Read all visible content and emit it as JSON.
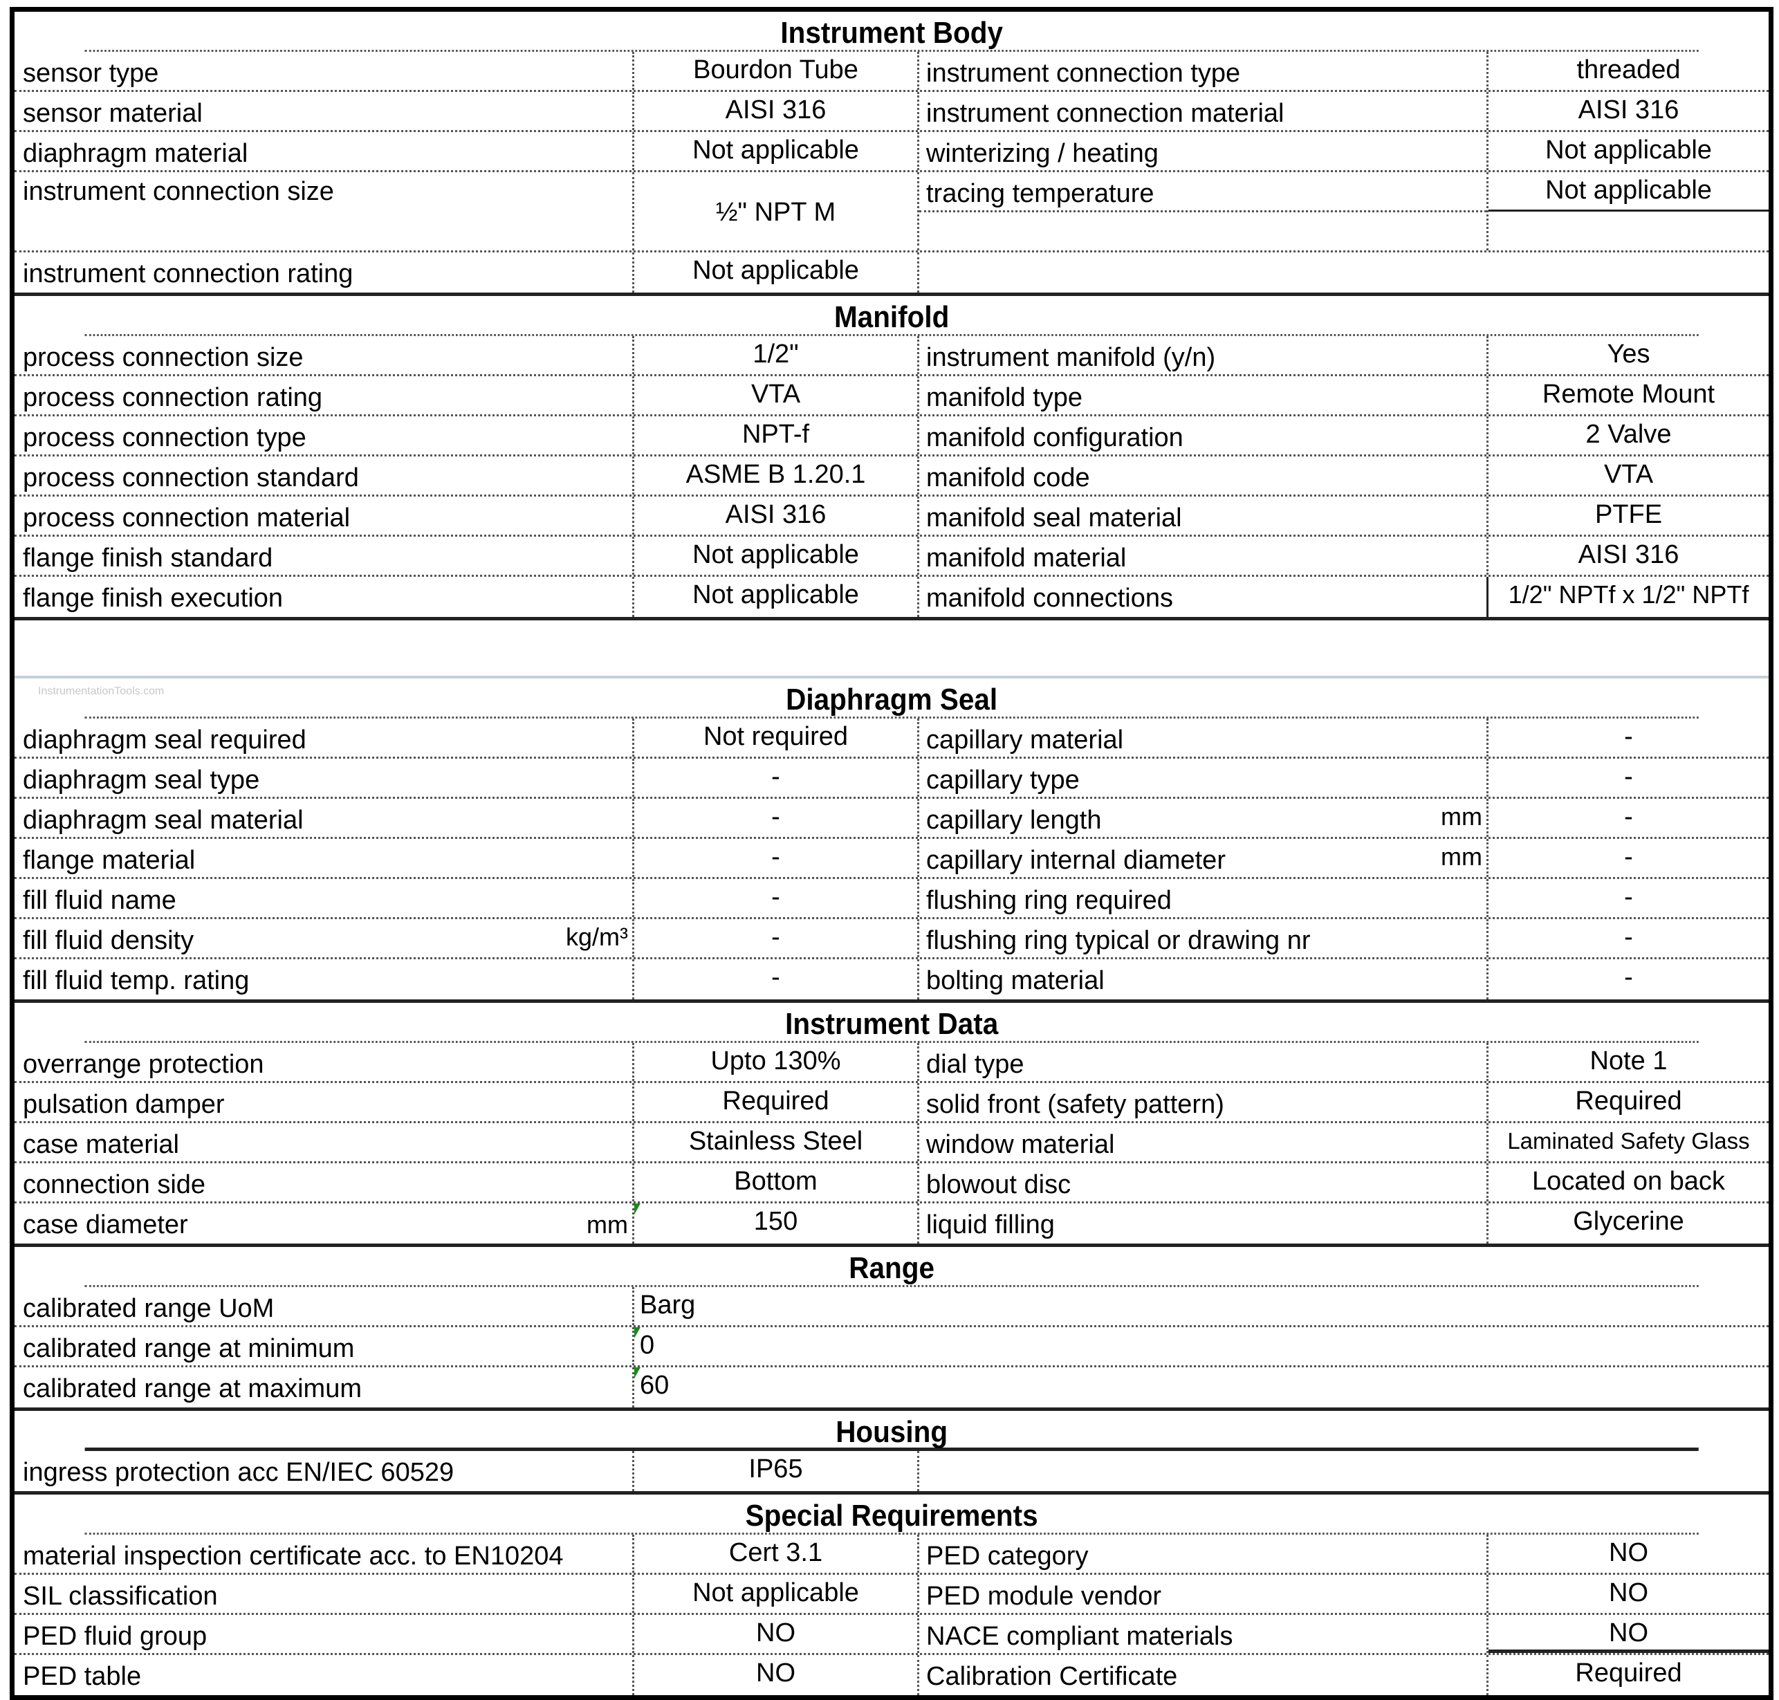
{
  "sections": {
    "instrument_body": {
      "title": "Instrument Body",
      "rows": [
        {
          "l_label": "sensor type",
          "l_value": "Bourdon Tube",
          "r_label": "instrument connection type",
          "r_value": "threaded"
        },
        {
          "l_label": "sensor material",
          "l_value": "AISI 316",
          "r_label": "instrument connection material",
          "r_value": "AISI 316"
        },
        {
          "l_label": "diaphragm material",
          "l_value": "Not applicable",
          "r_label": "winterizing / heating",
          "r_value": "Not applicable"
        },
        {
          "l_label": "instrument connection size",
          "l_value": "½\" NPT M",
          "r_label": "tracing temperature",
          "r_value": "Not applicable"
        },
        {
          "l_label": "instrument connection rating",
          "l_value": "Not applicable",
          "r_label": "",
          "r_value": ""
        }
      ]
    },
    "manifold": {
      "title": "Manifold",
      "rows": [
        {
          "l_label": "process connection size",
          "l_value": "1/2\"",
          "r_label": "instrument manifold (y/n)",
          "r_value": "Yes"
        },
        {
          "l_label": "process connection rating",
          "l_value": "VTA",
          "r_label": "manifold type",
          "r_value": "Remote Mount"
        },
        {
          "l_label": "process connection type",
          "l_value": "NPT-f",
          "r_label": "manifold configuration",
          "r_value": "2 Valve"
        },
        {
          "l_label": "process connection standard",
          "l_value": "ASME B 1.20.1",
          "r_label": "manifold code",
          "r_value": "VTA"
        },
        {
          "l_label": "process connection material",
          "l_value": "AISI 316",
          "r_label": "manifold seal material",
          "r_value": "PTFE"
        },
        {
          "l_label": "flange finish standard",
          "l_value": "Not applicable",
          "r_label": "manifold material",
          "r_value": "AISI 316"
        },
        {
          "l_label": "flange finish execution",
          "l_value": "Not applicable",
          "r_label": "manifold connections",
          "r_value": "1/2\" NPTf x 1/2\" NPTf"
        }
      ]
    },
    "watermark": "InstrumentationTools.com",
    "diaphragm_seal": {
      "title": "Diaphragm Seal",
      "rows": [
        {
          "l_label": "diaphragm seal required",
          "l_unit": "",
          "l_value": "Not required",
          "r_label": "capillary material",
          "r_unit": "",
          "r_value": "-"
        },
        {
          "l_label": "diaphragm seal type",
          "l_unit": "",
          "l_value": "-",
          "r_label": "capillary type",
          "r_unit": "",
          "r_value": "-"
        },
        {
          "l_label": "diaphragm seal material",
          "l_unit": "",
          "l_value": "-",
          "r_label": "capillary length",
          "r_unit": "mm",
          "r_value": "-"
        },
        {
          "l_label": "flange material",
          "l_unit": "",
          "l_value": "-",
          "r_label": "capillary internal diameter",
          "r_unit": "mm",
          "r_value": "-"
        },
        {
          "l_label": "fill fluid name",
          "l_unit": "",
          "l_value": "-",
          "r_label": "flushing ring required",
          "r_unit": "",
          "r_value": "-"
        },
        {
          "l_label": "fill fluid density",
          "l_unit": "kg/m³",
          "l_value": "-",
          "r_label": "flushing ring typical or drawing nr",
          "r_unit": "",
          "r_value": "-"
        },
        {
          "l_label": "fill fluid temp. rating",
          "l_unit": "",
          "l_value": "-",
          "r_label": "bolting material",
          "r_unit": "",
          "r_value": "-"
        }
      ]
    },
    "instrument_data": {
      "title": "Instrument Data",
      "rows": [
        {
          "l_label": "overrange protection",
          "l_unit": "",
          "l_value": "Upto 130%",
          "r_label": "dial type",
          "r_value": "Note 1"
        },
        {
          "l_label": "pulsation damper",
          "l_unit": "",
          "l_value": "Required",
          "r_label": "solid front (safety pattern)",
          "r_value": "Required"
        },
        {
          "l_label": "case material",
          "l_unit": "",
          "l_value": "Stainless Steel",
          "r_label": "window material",
          "r_value": "Laminated Safety Glass"
        },
        {
          "l_label": "connection side",
          "l_unit": "",
          "l_value": "Bottom",
          "r_label": "blowout disc",
          "r_value": "Located on back"
        },
        {
          "l_label": "case diameter",
          "l_unit": "mm",
          "l_value": "150",
          "r_label": "liquid filling",
          "r_value": "Glycerine"
        }
      ]
    },
    "range": {
      "title": "Range",
      "rows": [
        {
          "label": "calibrated range UoM",
          "value": "Barg"
        },
        {
          "label": "calibrated range at minimum",
          "value": "0"
        },
        {
          "label": "calibrated range at maximum",
          "value": "60"
        }
      ]
    },
    "housing": {
      "title": "Housing",
      "rows": [
        {
          "l_label": "ingress protection acc EN/IEC 60529",
          "l_value": "IP65"
        }
      ]
    },
    "special_requirements": {
      "title": "Special Requirements",
      "rows": [
        {
          "l_label": "material inspection certificate acc. to EN10204",
          "l_value": "Cert 3.1",
          "r_label": "PED category",
          "r_value": "NO"
        },
        {
          "l_label": "SIL classification",
          "l_value": "Not applicable",
          "r_label": "PED module vendor",
          "r_value": "NO"
        },
        {
          "l_label": "PED fluid group",
          "l_value": "NO",
          "r_label": "NACE compliant materials",
          "r_value": "NO"
        },
        {
          "l_label": "PED table",
          "l_value": "NO",
          "r_label": "Calibration Certificate",
          "r_value": "Required"
        }
      ]
    }
  },
  "colors": {
    "border": "#000000",
    "dotted_rule": "#555555",
    "comment_marker": "#1a8a1a",
    "watermark": "#c8c8c8"
  }
}
